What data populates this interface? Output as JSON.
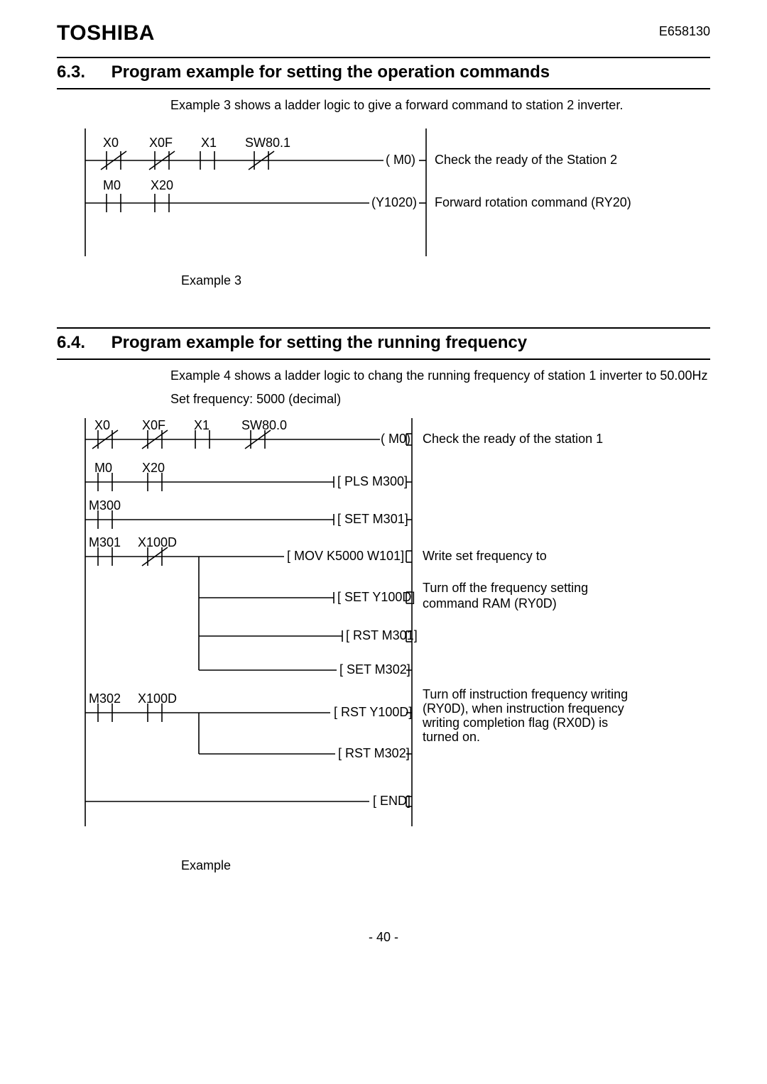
{
  "header": {
    "brand": "TOSHIBA",
    "docnum": "E658130"
  },
  "section63": {
    "num": "6.3.",
    "title": "Program example for setting the operation commands",
    "desc": "Example 3 shows a ladder logic to give a forward command to station 2 inverter.",
    "caption": "Example 3",
    "contacts": {
      "r1c1": "X0",
      "r1c2": "X0F",
      "r1c3": "X1",
      "r1c4": "SW80.1",
      "r2c1": "M0",
      "r2c2": "X20"
    },
    "outputs": {
      "r1": "( M0)",
      "r2": "(Y1020)"
    },
    "notes": {
      "r1": "Check the ready of the Station 2",
      "r2": "Forward rotation command (RY20)"
    }
  },
  "section64": {
    "num": "6.4.",
    "title": "Program example for setting the running frequency",
    "desc1": "Example 4 shows a ladder logic to chang the running frequency of station 1 inverter to 50.00Hz",
    "desc2": "Set frequency:    5000 (decimal)",
    "caption": "Example",
    "contacts": {
      "r1c1": "X0",
      "r1c2": "X0F",
      "r1c3": "X1",
      "r1c4": "SW80.0",
      "r2c1": "M0",
      "r2c2": "X20",
      "r3c1": "M300",
      "r4c1": "M301",
      "r4c2": "X100D",
      "r8c1": "M302",
      "r8c2": "X100D"
    },
    "instr": {
      "r1": "( M0)",
      "r2": "[ PLS   M300]",
      "r3": "[ SET   M301]",
      "r4": "[ MOV   K5000   W101]",
      "r5": "[ SET   Y100D]",
      "r6": "[ RST M301]",
      "r7": "[ SET M302]",
      "r8": "[ RST   Y100D]",
      "r9": "[ RST   M302]",
      "r10": "[ END]"
    },
    "notes": {
      "r1": "Check the ready of the station 1",
      "r4": "Write     set     frequency     to",
      "r5a": "Turn off the frequency setting",
      "r5b": "command RAM (RY0D)",
      "r8a": "Turn off instruction frequency writing",
      "r8b": "(RY0D), when instruction frequency",
      "r8c": "writing completion flag (RX0D) is",
      "r8d": "turned on."
    }
  },
  "footer": {
    "page": "- 40 -"
  }
}
